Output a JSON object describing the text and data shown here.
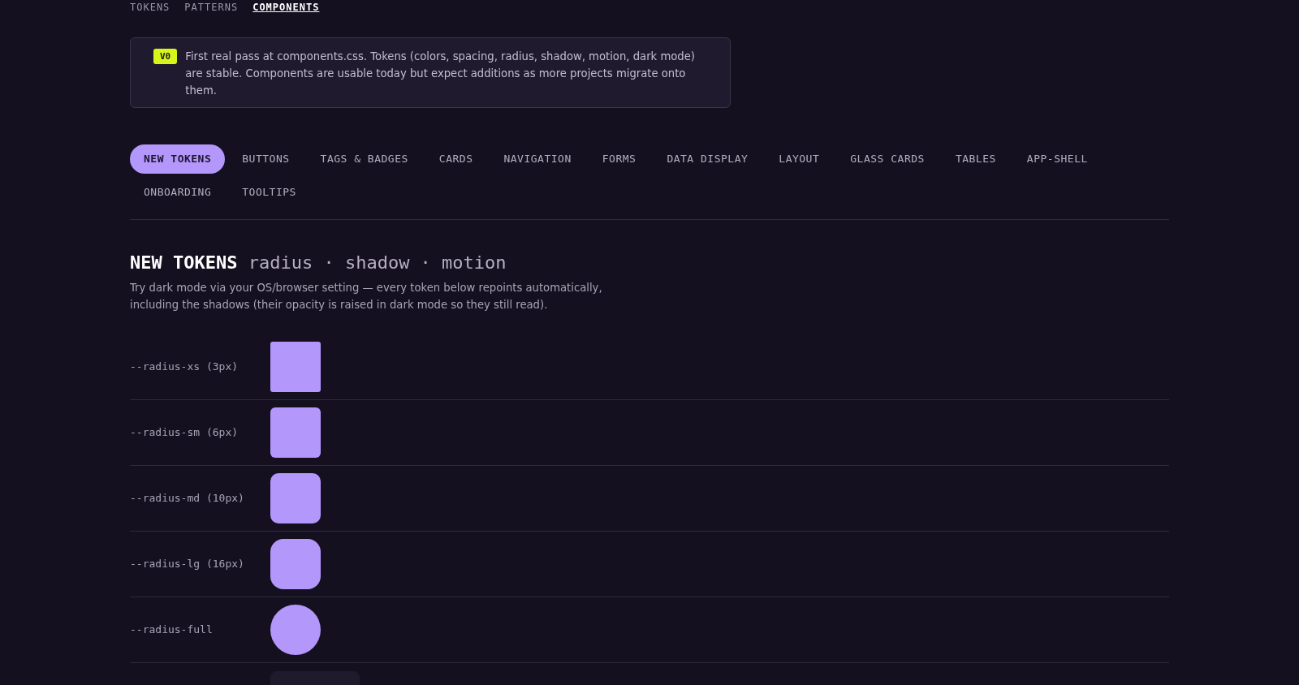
{
  "top_nav": [
    {
      "label": "TOKENS",
      "selected": false
    },
    {
      "label": "PATTERNS",
      "selected": false
    },
    {
      "label": "COMPONENTS",
      "selected": true
    }
  ],
  "notice": {
    "badge": "V0",
    "text": "First real pass at components.css. Tokens (colors, spacing, radius, shadow, motion, dark mode) are stable. Components are usable today but expect additions as more projects migrate onto them."
  },
  "tabs": [
    {
      "label": "NEW TOKENS",
      "selected": true
    },
    {
      "label": "BUTTONS",
      "selected": false
    },
    {
      "label": "TAGS & BADGES",
      "selected": false
    },
    {
      "label": "CARDS",
      "selected": false
    },
    {
      "label": "NAVIGATION",
      "selected": false
    },
    {
      "label": "FORMS",
      "selected": false
    },
    {
      "label": "DATA DISPLAY",
      "selected": false
    },
    {
      "label": "LAYOUT",
      "selected": false
    },
    {
      "label": "GLASS CARDS",
      "selected": false
    },
    {
      "label": "TABLES",
      "selected": false
    },
    {
      "label": "APP-SHELL",
      "selected": false
    },
    {
      "label": "ONBOARDING",
      "selected": false
    },
    {
      "label": "TOOLTIPS",
      "selected": false
    }
  ],
  "section": {
    "title": "NEW TOKENS",
    "subtitle": "radius · shadow · motion",
    "description": "Try dark mode via your OS/browser setting — every token below repoints automatically, including the shadows (their opacity is raised in dark mode so they still read)."
  },
  "tokens": [
    {
      "kind": "xs",
      "label": "--radius-xs (3px)"
    },
    {
      "kind": "sm",
      "label": "--radius-sm (6px)"
    },
    {
      "kind": "md",
      "label": "--radius-md (10px)"
    },
    {
      "kind": "lg",
      "label": "--radius-lg (16px)"
    },
    {
      "kind": "full",
      "label": "--radius-full"
    },
    {
      "kind": "shadow"
    }
  ]
}
